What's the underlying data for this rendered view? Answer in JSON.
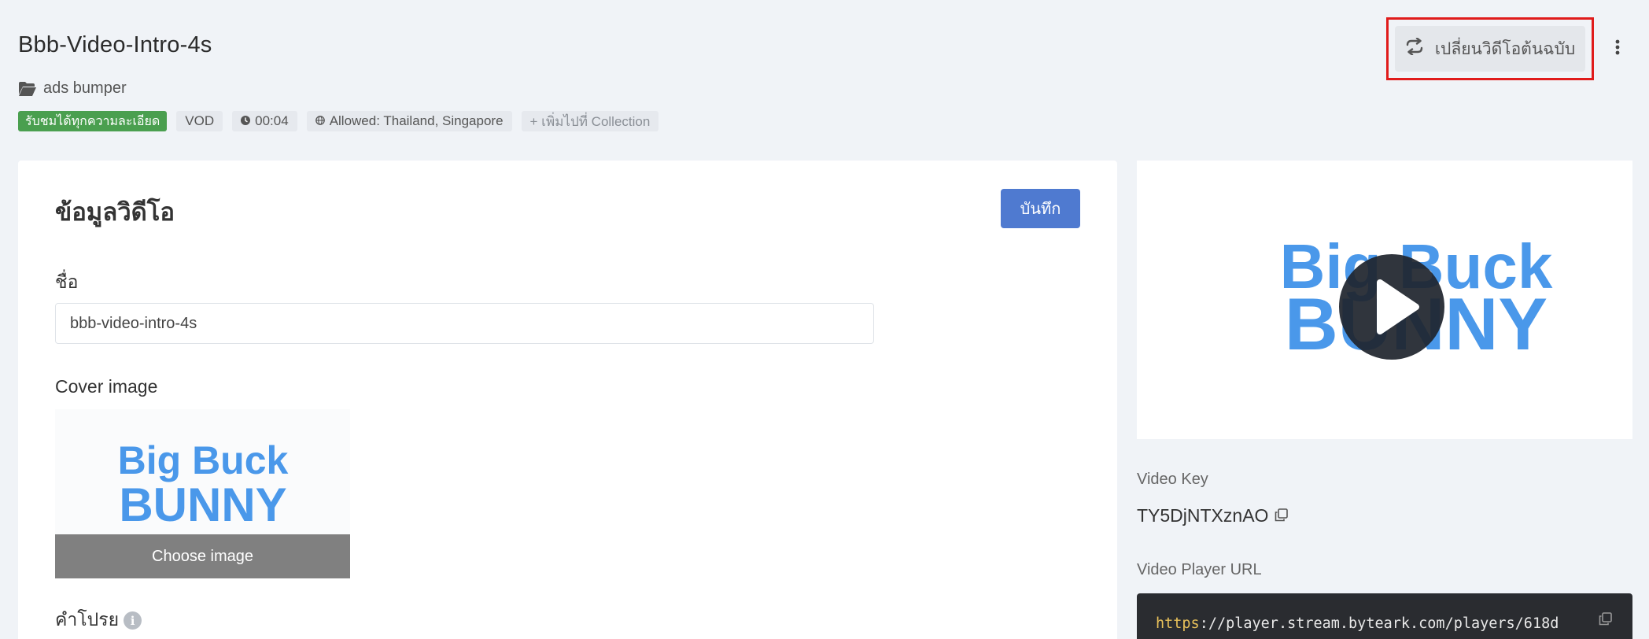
{
  "video": {
    "title": "Bbb-Video-Intro-4s",
    "folder": "ads bumper",
    "badges": {
      "quality": "รับชมได้ทุกความละเอียด",
      "type": "VOD",
      "duration": "00:04",
      "geo": "Allowed: Thailand, Singapore",
      "add_collection": "+ เพิ่มไปที่ Collection"
    }
  },
  "header": {
    "replace_label": "เปลี่ยนวิดีโอต้นฉบับ"
  },
  "form": {
    "heading": "ข้อมูลวิดีโอ",
    "save_label": "บันทึก",
    "name_label": "ชื่อ",
    "name_value": "bbb-video-intro-4s",
    "cover_label": "Cover image",
    "choose_label": "Choose image",
    "description_label": "คำโปรย"
  },
  "thumbnail": {
    "line1": "Big Buck",
    "line2": "BUNNY"
  },
  "sidebar": {
    "key_label": "Video Key",
    "key_value": "TY5DjNTXznAO",
    "url_label": "Video Player URL",
    "url_protocol": "https",
    "url_rest": "://player.stream.byteark.com/players/618d"
  },
  "colors": {
    "accent": "#4f7ad0",
    "badge_green": "#4a9f4f",
    "highlight_red": "#e01b1b",
    "logo_blue": "#4a98ea"
  }
}
